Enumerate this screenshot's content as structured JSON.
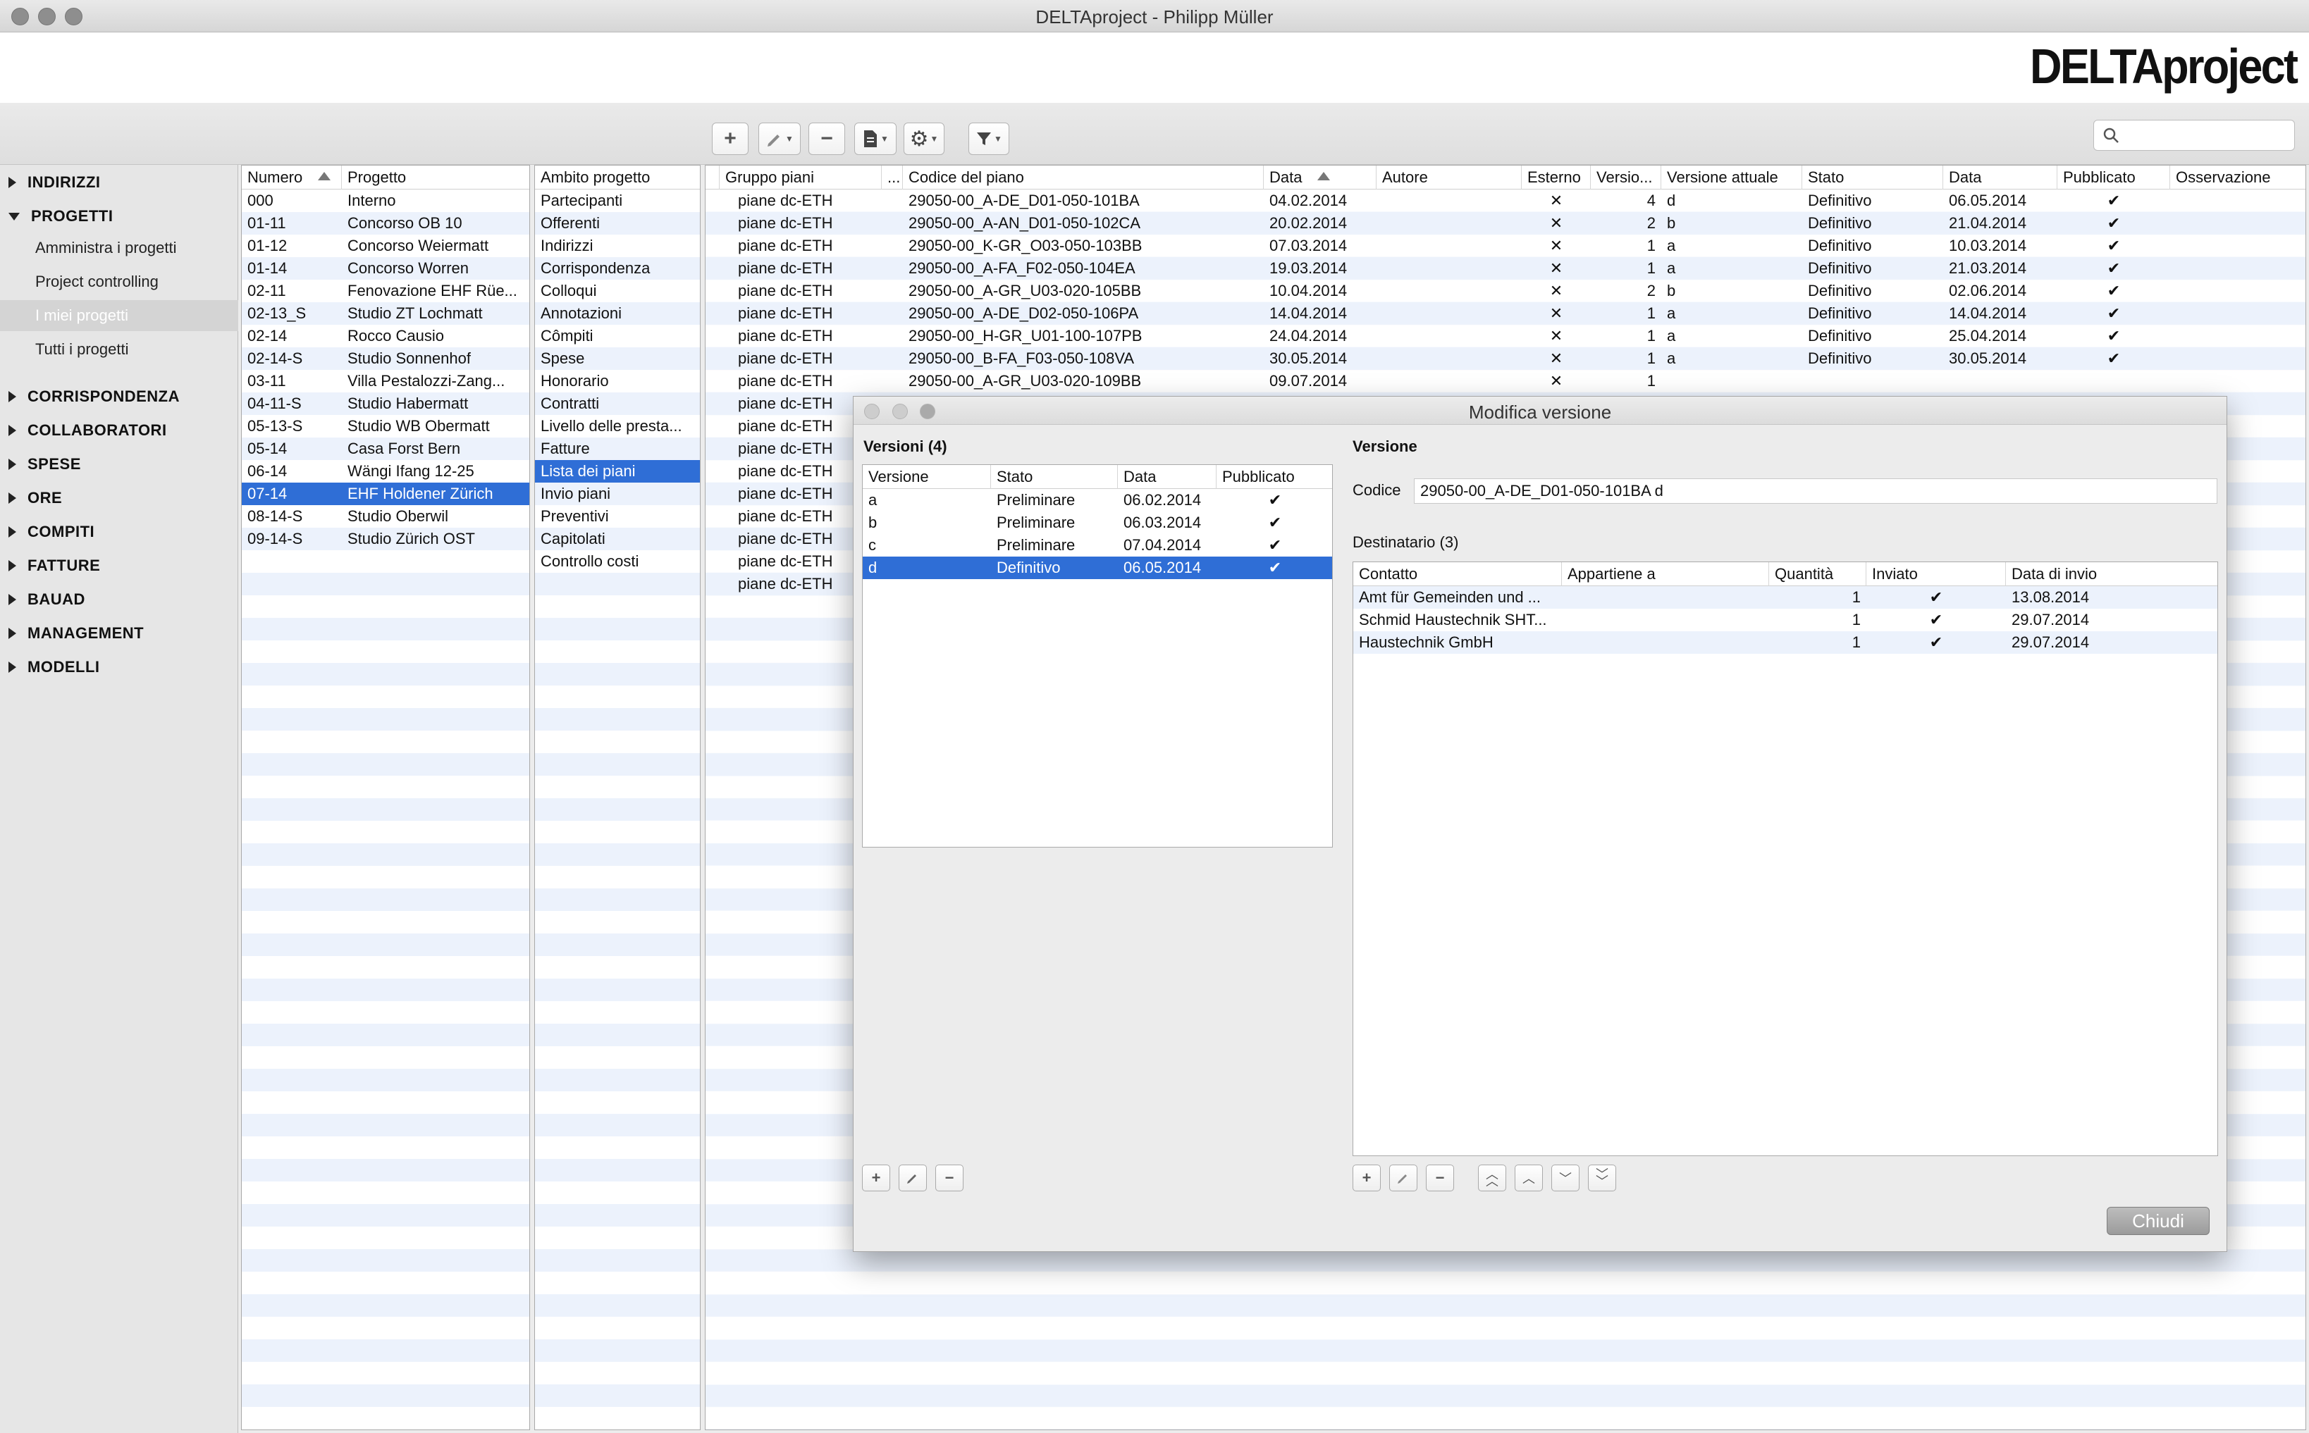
{
  "window": {
    "title": "DELTAproject - Philipp Müller"
  },
  "logo": "DELTAproject",
  "search": {
    "placeholder": ""
  },
  "sidebar": {
    "sections": [
      {
        "label": "INDIRIZZI",
        "expanded": false
      },
      {
        "label": "PROGETTI",
        "expanded": true
      },
      {
        "label": "CORRISPONDENZA",
        "expanded": false
      },
      {
        "label": "COLLABORATORI",
        "expanded": false
      },
      {
        "label": "SPESE",
        "expanded": false
      },
      {
        "label": "ORE",
        "expanded": false
      },
      {
        "label": "COMPITI",
        "expanded": false
      },
      {
        "label": "FATTURE",
        "expanded": false
      },
      {
        "label": "BAUAD",
        "expanded": false
      },
      {
        "label": "MANAGEMENT",
        "expanded": false
      },
      {
        "label": "MODELLI",
        "expanded": false
      }
    ],
    "progetti_items": [
      "Amministra i progetti",
      "Project controlling",
      "I miei progetti",
      "Tutti i progetti"
    ],
    "selected_item": "I miei progetti"
  },
  "projects": {
    "headers": [
      "Numero",
      "Progetto"
    ],
    "rows": [
      [
        "000",
        "Interno"
      ],
      [
        "01-11",
        "Concorso OB 10"
      ],
      [
        "01-12",
        "Concorso Weiermatt"
      ],
      [
        "01-14",
        "Concorso Worren"
      ],
      [
        "02-11",
        "Fenovazione EHF Rüe..."
      ],
      [
        "02-13_S",
        "Studio ZT Lochmatt"
      ],
      [
        "02-14",
        "Rocco Causio"
      ],
      [
        "02-14-S",
        "Studio  Sonnenhof"
      ],
      [
        "03-11",
        "Villa Pestalozzi-Zang..."
      ],
      [
        "04-11-S",
        "Studio Habermatt"
      ],
      [
        "05-13-S",
        "Studio WB Obermatt"
      ],
      [
        "05-14",
        "Casa Forst Bern"
      ],
      [
        "06-14",
        "Wängi Ifang 12-25"
      ],
      [
        "07-14",
        "EHF Holdener Zürich"
      ],
      [
        "08-14-S",
        "Studio Oberwil"
      ],
      [
        "09-14-S",
        "Studio Zürich OST"
      ]
    ],
    "selected_index": 13
  },
  "scope": {
    "header": "Ambito progetto",
    "items": [
      "Partecipanti",
      "Offerenti",
      "Indirizzi",
      "Corrispondenza",
      "Colloqui",
      "Annotazioni",
      "Cômpiti",
      "Spese",
      "Honorario",
      "Contratti",
      "Livello delle presta...",
      "Fatture",
      "Lista dei piani",
      "Invio piani",
      "Preventivi",
      "Capitolati",
      "Controllo costi"
    ],
    "selected_index": 12
  },
  "plans": {
    "headers": [
      "Gruppo piani",
      "...",
      "Codice del piano",
      "Data",
      "Autore",
      "Esterno",
      "Versio...",
      "Versione attuale",
      "Stato",
      "Data",
      "Pubblicato",
      "Osservazione"
    ],
    "rows": [
      {
        "gruppo": "piane dc-ETH",
        "codice": "29050-00_A-DE_D01-050-101BA",
        "data": "04.02.2014",
        "esterno": "✕",
        "versioni": "4",
        "attuale": "d",
        "stato": "Definitivo",
        "data2": "06.05.2014",
        "pubblicato": "✔"
      },
      {
        "gruppo": "piane dc-ETH",
        "codice": "29050-00_A-AN_D01-050-102CA",
        "data": "20.02.2014",
        "esterno": "✕",
        "versioni": "2",
        "attuale": "b",
        "stato": "Definitivo",
        "data2": "21.04.2014",
        "pubblicato": "✔"
      },
      {
        "gruppo": "piane dc-ETH",
        "codice": "29050-00_K-GR_O03-050-103BB",
        "data": "07.03.2014",
        "esterno": "✕",
        "versioni": "1",
        "attuale": "a",
        "stato": "Definitivo",
        "data2": "10.03.2014",
        "pubblicato": "✔"
      },
      {
        "gruppo": "piane dc-ETH",
        "codice": "29050-00_A-FA_F02-050-104EA",
        "data": "19.03.2014",
        "esterno": "✕",
        "versioni": "1",
        "attuale": "a",
        "stato": "Definitivo",
        "data2": "21.03.2014",
        "pubblicato": "✔"
      },
      {
        "gruppo": "piane dc-ETH",
        "codice": "29050-00_A-GR_U03-020-105BB",
        "data": "10.04.2014",
        "esterno": "✕",
        "versioni": "2",
        "attuale": "b",
        "stato": "Definitivo",
        "data2": "02.06.2014",
        "pubblicato": "✔"
      },
      {
        "gruppo": "piane dc-ETH",
        "codice": "29050-00_A-DE_D02-050-106PA",
        "data": "14.04.2014",
        "esterno": "✕",
        "versioni": "1",
        "attuale": "a",
        "stato": "Definitivo",
        "data2": "14.04.2014",
        "pubblicato": "✔"
      },
      {
        "gruppo": "piane dc-ETH",
        "codice": "29050-00_H-GR_U01-100-107PB",
        "data": "24.04.2014",
        "esterno": "✕",
        "versioni": "1",
        "attuale": "a",
        "stato": "Definitivo",
        "data2": "25.04.2014",
        "pubblicato": "✔"
      },
      {
        "gruppo": "piane dc-ETH",
        "codice": "29050-00_B-FA_F03-050-108VA",
        "data": "30.05.2014",
        "esterno": "✕",
        "versioni": "1",
        "attuale": "a",
        "stato": "Definitivo",
        "data2": "30.05.2014",
        "pubblicato": "✔"
      },
      {
        "gruppo": "piane dc-ETH",
        "codice": "29050-00_A-GR_U03-020-109BB",
        "data": "09.07.2014",
        "esterno": "✕",
        "versioni": "1",
        "attuale": "",
        "stato": "",
        "data2": "",
        "pubblicato": ""
      },
      {
        "gruppo": "piane dc-ETH",
        "codice": "",
        "data": "",
        "esterno": "",
        "versioni": "",
        "attuale": "",
        "stato": "",
        "data2": "",
        "pubblicato": ""
      },
      {
        "gruppo": "piane dc-ETH",
        "codice": "",
        "data": "",
        "esterno": "",
        "versioni": "",
        "attuale": "",
        "stato": "",
        "data2": "",
        "pubblicato": ""
      },
      {
        "gruppo": "piane dc-ETH",
        "codice": "",
        "data": "",
        "esterno": "",
        "versioni": "",
        "attuale": "",
        "stato": "",
        "data2": "",
        "pubblicato": ""
      },
      {
        "gruppo": "piane dc-ETH",
        "codice": "",
        "data": "",
        "esterno": "",
        "versioni": "",
        "attuale": "",
        "stato": "",
        "data2": "",
        "pubblicato": ""
      },
      {
        "gruppo": "piane dc-ETH",
        "codice": "",
        "data": "",
        "esterno": "",
        "versioni": "",
        "attuale": "",
        "stato": "",
        "data2": "",
        "pubblicato": ""
      },
      {
        "gruppo": "piane dc-ETH",
        "codice": "",
        "data": "",
        "esterno": "",
        "versioni": "",
        "attuale": "",
        "stato": "",
        "data2": "",
        "pubblicato": ""
      },
      {
        "gruppo": "piane dc-ETH",
        "codice": "",
        "data": "",
        "esterno": "",
        "versioni": "",
        "attuale": "",
        "stato": "",
        "data2": "",
        "pubblicato": ""
      },
      {
        "gruppo": "piane dc-ETH",
        "codice": "",
        "data": "",
        "esterno": "",
        "versioni": "",
        "attuale": "",
        "stato": "",
        "data2": "",
        "pubblicato": ""
      },
      {
        "gruppo": "piane dc-ETH",
        "codice": "",
        "data": "",
        "esterno": "",
        "versioni": "",
        "attuale": "",
        "stato": "",
        "data2": "",
        "pubblicato": ""
      }
    ]
  },
  "dialog": {
    "title": "Modifica versione",
    "versions_title": "Versioni (4)",
    "versions_headers": [
      "Versione",
      "Stato",
      "Data",
      "Pubblicato"
    ],
    "versions": [
      [
        "a",
        "Preliminare",
        "06.02.2014",
        "✔"
      ],
      [
        "b",
        "Preliminare",
        "06.03.2014",
        "✔"
      ],
      [
        "c",
        "Preliminare",
        "07.04.2014",
        "✔"
      ],
      [
        "d",
        "Definitivo",
        "06.05.2014",
        "✔"
      ]
    ],
    "versions_selected_index": 3,
    "detail_title": "Versione",
    "codice_label": "Codice",
    "codice_value": "29050-00_A-DE_D01-050-101BA d",
    "recipients_title": "Destinatario (3)",
    "recipients_headers": [
      "Contatto",
      "Appartiene a",
      "Quantità",
      "Inviato",
      "Data di invio"
    ],
    "recipients": [
      [
        "Amt für Gemeinden und ...",
        "",
        "1",
        "✔",
        "13.08.2014"
      ],
      [
        "Schmid Haustechnik SHT...",
        "",
        "1",
        "✔",
        "29.07.2014"
      ],
      [
        "Haustechnik GmbH",
        "",
        "1",
        "✔",
        "29.07.2014"
      ]
    ],
    "close_label": "Chiudi"
  }
}
